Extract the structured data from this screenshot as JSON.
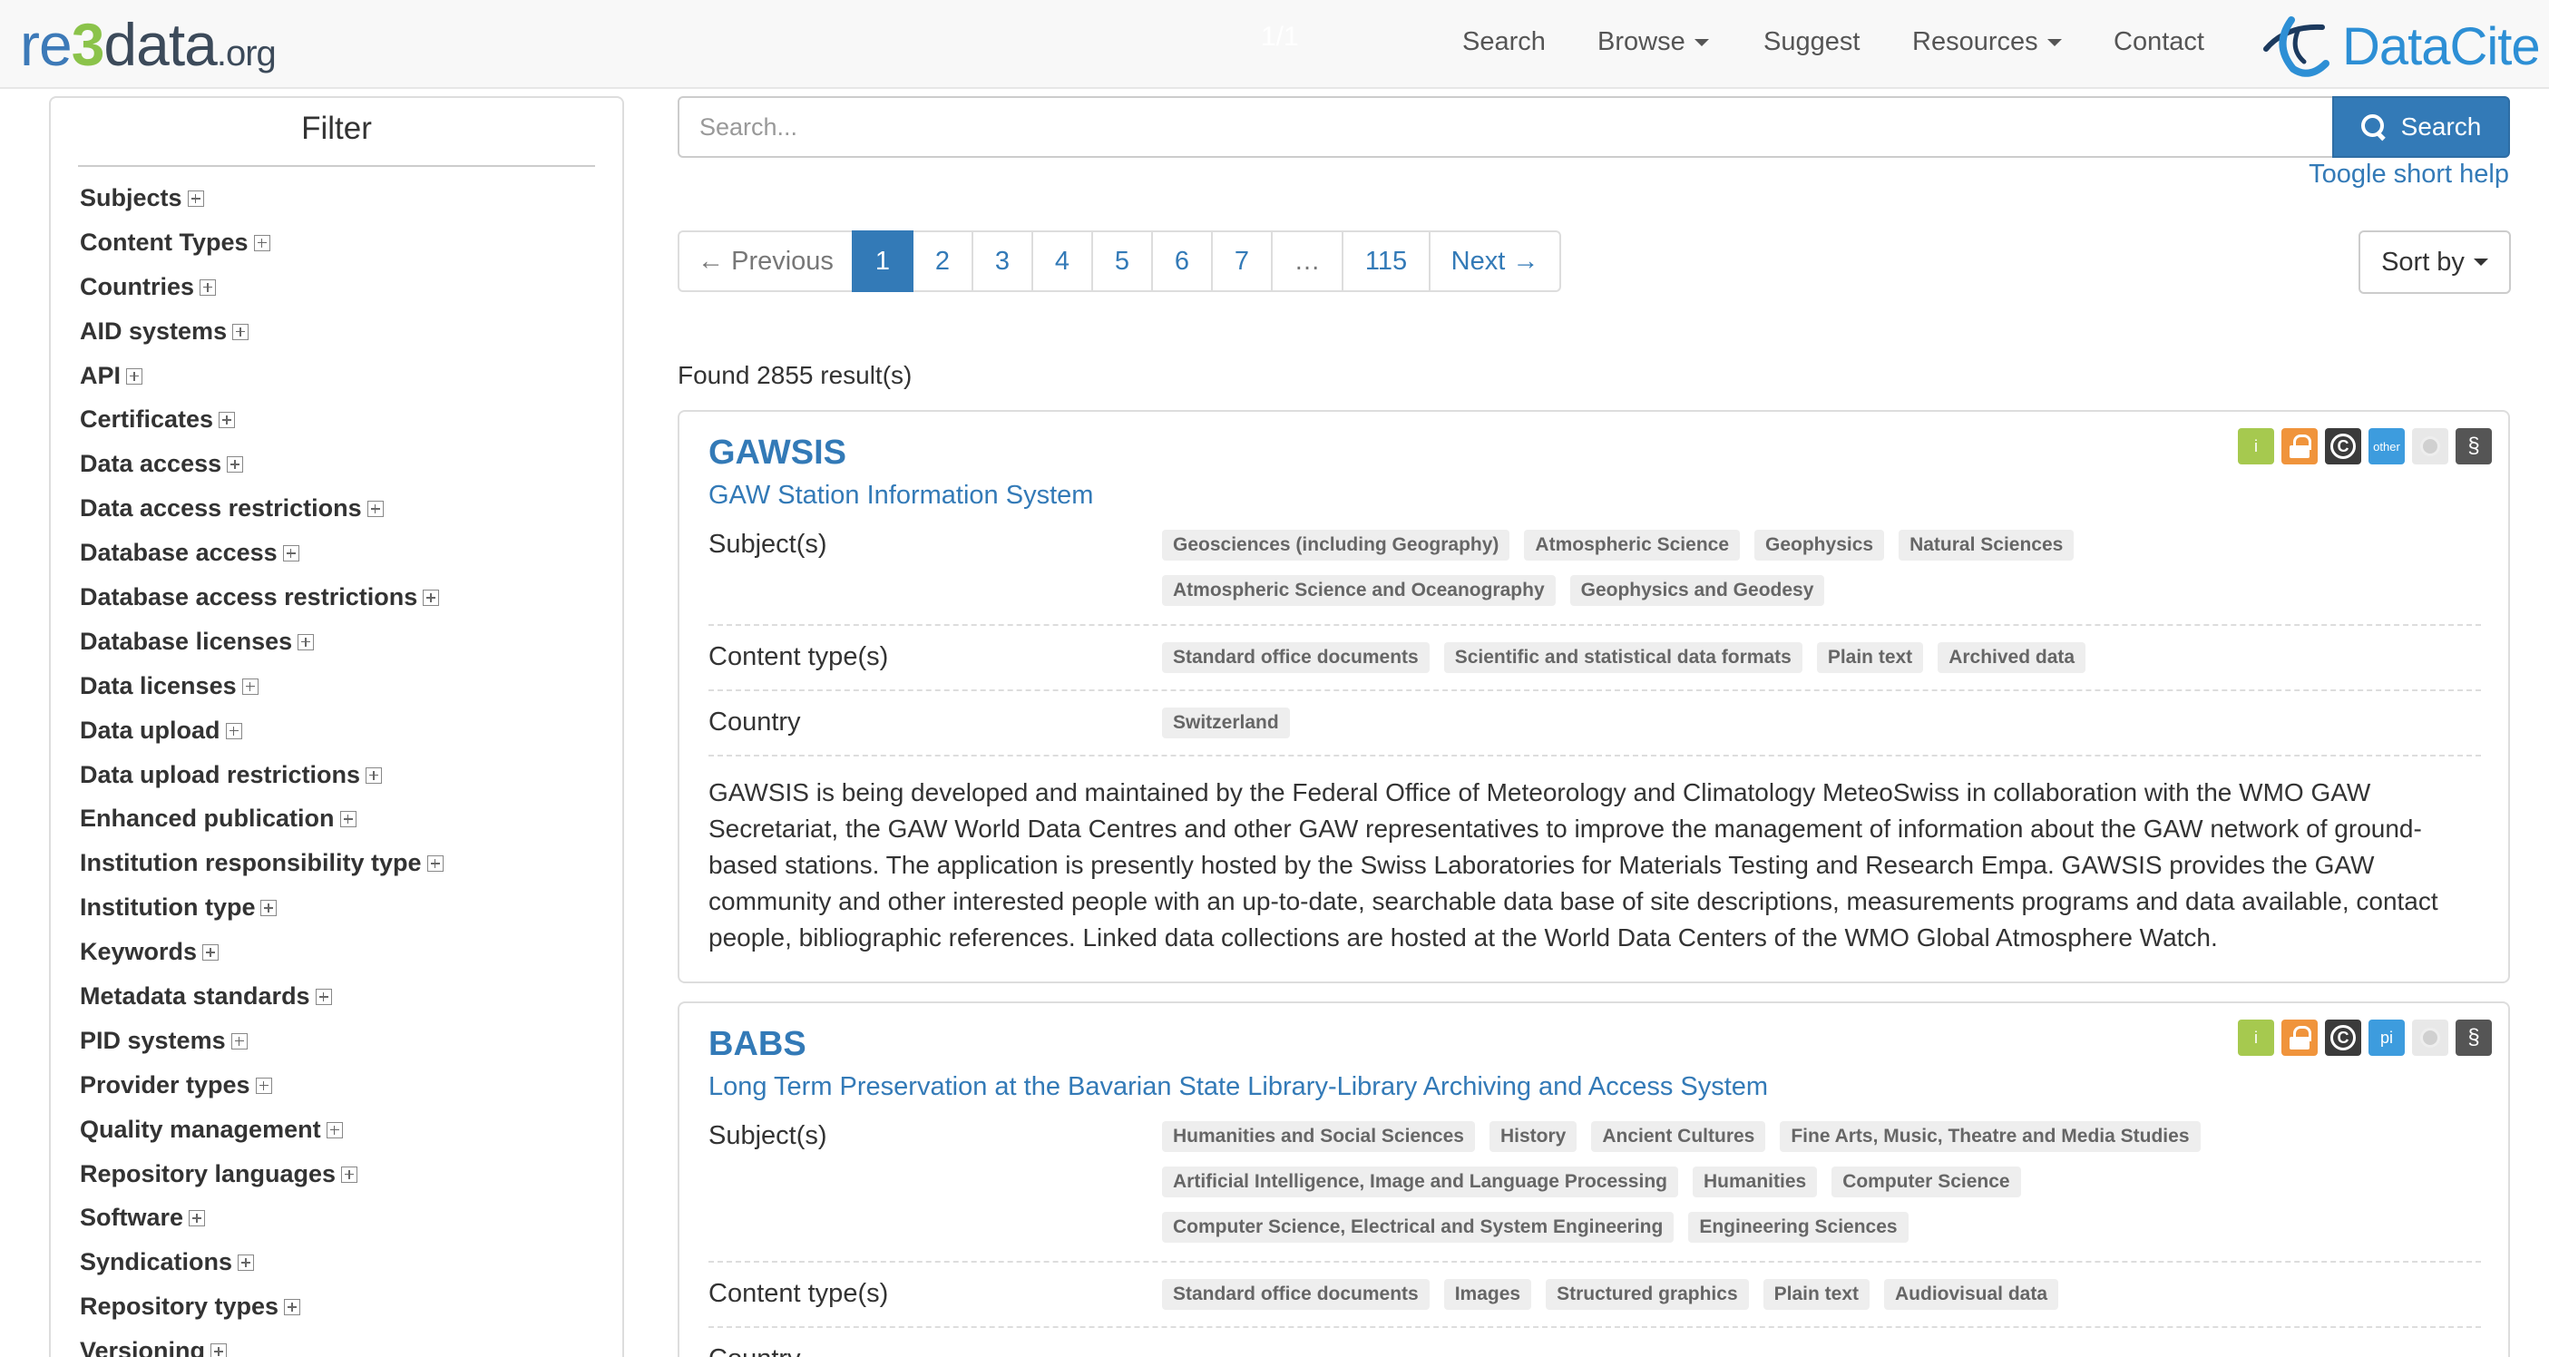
{
  "navbar": {
    "logo": {
      "re": "re",
      "three": "3",
      "data": "data",
      "org": ".org"
    },
    "ghost_text": "1/1",
    "items": [
      {
        "label": "Search",
        "dropdown": false
      },
      {
        "label": "Browse",
        "dropdown": true
      },
      {
        "label": "Suggest",
        "dropdown": false
      },
      {
        "label": "Resources",
        "dropdown": true
      },
      {
        "label": "Contact",
        "dropdown": false
      }
    ],
    "partner_logo": "DataCite"
  },
  "sidebar": {
    "title": "Filter",
    "items": [
      "Subjects",
      "Content Types",
      "Countries",
      "AID systems",
      "API",
      "Certificates",
      "Data access",
      "Data access restrictions",
      "Database access",
      "Database access restrictions",
      "Database licenses",
      "Data licenses",
      "Data upload",
      "Data upload restrictions",
      "Enhanced publication",
      "Institution responsibility type",
      "Institution type",
      "Keywords",
      "Metadata standards",
      "PID systems",
      "Provider types",
      "Quality management",
      "Repository languages",
      "Software",
      "Syndications",
      "Repository types",
      "Versioning"
    ]
  },
  "search": {
    "placeholder": "Search...",
    "button_label": "Search",
    "help_link": "Toogle short help"
  },
  "pagination": {
    "previous": "← Previous",
    "pages": [
      "1",
      "2",
      "3",
      "4",
      "5",
      "6",
      "7",
      "…",
      "115"
    ],
    "active_page": "1",
    "next": "Next →"
  },
  "sort": {
    "label": "Sort by"
  },
  "results": {
    "found_text": "Found 2855 result(s)",
    "items": [
      {
        "title": "GAWSIS",
        "subtitle": "GAW Station Information System",
        "badges": [
          "info",
          "open-access",
          "copyright",
          "other",
          "certificate",
          "policy"
        ],
        "badge_text": {
          "info": "i",
          "copyright": "C",
          "other": "other",
          "policy": "§"
        },
        "subjects_label": "Subject(s)",
        "subjects": [
          "Geosciences (including Geography)",
          "Atmospheric Science",
          "Geophysics",
          "Natural Sciences",
          "Atmospheric Science and Oceanography",
          "Geophysics and Geodesy"
        ],
        "content_types_label": "Content type(s)",
        "content_types": [
          "Standard office documents",
          "Scientific and statistical data formats",
          "Plain text",
          "Archived data"
        ],
        "country_label": "Country",
        "countries": [
          "Switzerland"
        ],
        "description": "GAWSIS is being developed and maintained by the Federal Office of Meteorology and Climatology MeteoSwiss in collaboration with the WMO GAW Secretariat, the GAW World Data Centres and other GAW representatives to improve the management of information about the GAW network of ground-based stations. The application is presently hosted by the Swiss Laboratories for Materials Testing and Research Empa. GAWSIS provides the GAW community and other interested people with an up-to-date, searchable data base of site descriptions, measurements programs and data available, contact people, bibliographic references. Linked data collections are hosted at the World Data Centers of the WMO Global Atmosphere Watch."
      },
      {
        "title": "BABS",
        "subtitle": "Long Term Preservation at the Bavarian State Library-Library Archiving and Access System",
        "badges": [
          "info",
          "open-access",
          "copyright",
          "pi",
          "certificate",
          "policy"
        ],
        "badge_text": {
          "info": "i",
          "copyright": "C",
          "pi": "pi",
          "policy": "§"
        },
        "subjects_label": "Subject(s)",
        "subjects": [
          "Humanities and Social Sciences",
          "History",
          "Ancient Cultures",
          "Fine Arts, Music, Theatre and Media Studies",
          "Artificial Intelligence, Image and Language Processing",
          "Humanities",
          "Computer Science",
          "Computer Science, Electrical and System Engineering",
          "Engineering Sciences"
        ],
        "content_types_label": "Content type(s)",
        "content_types": [
          "Standard office documents",
          "Images",
          "Structured graphics",
          "Plain text",
          "Audiovisual data"
        ],
        "country_label": "Country"
      }
    ]
  }
}
